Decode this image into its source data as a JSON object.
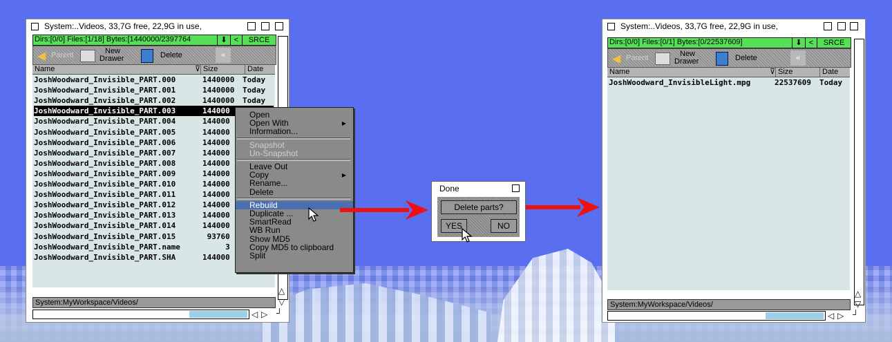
{
  "colors": {
    "desktop": "#5a6ff0",
    "lister_green": "#55e055",
    "list_bg": "#d8e6e6",
    "menu_highlight": "#4a6fb0",
    "arrow": "#ee1111"
  },
  "left_window": {
    "title": "System:..Videos,  33,7G free, 22,9G in use,",
    "status": "Dirs:[0/0] Files:[1/18] Bytes:[1440000/2397764",
    "srce": "SRCE",
    "lt": "<",
    "parent": "Parent",
    "new_drawer_1": "New",
    "new_drawer_2": "Drawer",
    "delete": "Delete",
    "columns": {
      "name": "Name",
      "size": "Size",
      "date": "Date"
    },
    "rows": [
      {
        "name": "JoshWoodward_Invisible_PART.000",
        "size": "1440000",
        "date": "Today"
      },
      {
        "name": "JoshWoodward_Invisible_PART.001",
        "size": "1440000",
        "date": "Today"
      },
      {
        "name": "JoshWoodward_Invisible_PART.002",
        "size": "1440000",
        "date": "Today"
      },
      {
        "name": "JoshWoodward_Invisible_PART.003",
        "size": "144000",
        "date": ""
      },
      {
        "name": "JoshWoodward_Invisible_PART.004",
        "size": "144000",
        "date": ""
      },
      {
        "name": "JoshWoodward_Invisible_PART.005",
        "size": "144000",
        "date": ""
      },
      {
        "name": "JoshWoodward_Invisible_PART.006",
        "size": "144000",
        "date": ""
      },
      {
        "name": "JoshWoodward_Invisible_PART.007",
        "size": "144000",
        "date": ""
      },
      {
        "name": "JoshWoodward_Invisible_PART.008",
        "size": "144000",
        "date": ""
      },
      {
        "name": "JoshWoodward_Invisible_PART.009",
        "size": "144000",
        "date": ""
      },
      {
        "name": "JoshWoodward_Invisible_PART.010",
        "size": "144000",
        "date": ""
      },
      {
        "name": "JoshWoodward_Invisible_PART.011",
        "size": "144000",
        "date": ""
      },
      {
        "name": "JoshWoodward_Invisible_PART.012",
        "size": "144000",
        "date": ""
      },
      {
        "name": "JoshWoodward_Invisible_PART.013",
        "size": "144000",
        "date": ""
      },
      {
        "name": "JoshWoodward_Invisible_PART.014",
        "size": "144000",
        "date": ""
      },
      {
        "name": "JoshWoodward_Invisible_PART.015",
        "size": " 93760",
        "date": ""
      },
      {
        "name": "JoshWoodward_Invisible_PART.name",
        "size": "     3",
        "date": ""
      },
      {
        "name": "JoshWoodward_Invisible_PART.SHA",
        "size": "144000",
        "date": ""
      }
    ],
    "selected_index": 3,
    "path": "System:MyWorkspace/Videos/"
  },
  "context_menu": {
    "items": [
      {
        "label": "Open",
        "disabled": false,
        "submenu": false
      },
      {
        "label": "Open With",
        "disabled": false,
        "submenu": true
      },
      {
        "label": "Information...",
        "disabled": false,
        "submenu": false
      },
      {
        "sep": true
      },
      {
        "label": "Snapshot",
        "disabled": true,
        "submenu": false
      },
      {
        "label": "Un-Snapshot",
        "disabled": true,
        "submenu": false
      },
      {
        "sep": true
      },
      {
        "label": "Leave Out",
        "disabled": false,
        "submenu": false
      },
      {
        "label": "Copy",
        "disabled": false,
        "submenu": true
      },
      {
        "label": "Rename...",
        "disabled": false,
        "submenu": false
      },
      {
        "label": "Delete",
        "disabled": false,
        "submenu": false
      },
      {
        "sep": true
      },
      {
        "label": "Rebuild",
        "disabled": false,
        "submenu": false,
        "highlight": true
      },
      {
        "label": "Duplicate ...",
        "disabled": false,
        "submenu": false
      },
      {
        "label": "SmartRead",
        "disabled": false,
        "submenu": false
      },
      {
        "label": "WB Run",
        "disabled": false,
        "submenu": false
      },
      {
        "label": "Show MD5",
        "disabled": false,
        "submenu": false
      },
      {
        "label": "Copy MD5 to clipboard",
        "disabled": false,
        "submenu": false
      },
      {
        "label": "Split",
        "disabled": false,
        "submenu": false
      }
    ]
  },
  "dialog": {
    "title": "Done",
    "message": "Delete parts?",
    "yes": "YES",
    "no": "NO"
  },
  "right_window": {
    "title": "System:..Videos,  33,7G free, 22,9G in use,",
    "status": "Dirs:[0/0] Files:[0/1] Bytes:[0/22537609]",
    "srce": "SRCE",
    "lt": "<",
    "parent": "Parent",
    "new_drawer_1": "New",
    "new_drawer_2": "Drawer",
    "delete": "Delete",
    "columns": {
      "name": "Name",
      "size": "Size",
      "date": "Date"
    },
    "rows": [
      {
        "name": "JoshWoodward_InvisibleLight.mpg",
        "size": "22537609",
        "date": "Today"
      }
    ],
    "path": "System:MyWorkspace/Videos/"
  }
}
